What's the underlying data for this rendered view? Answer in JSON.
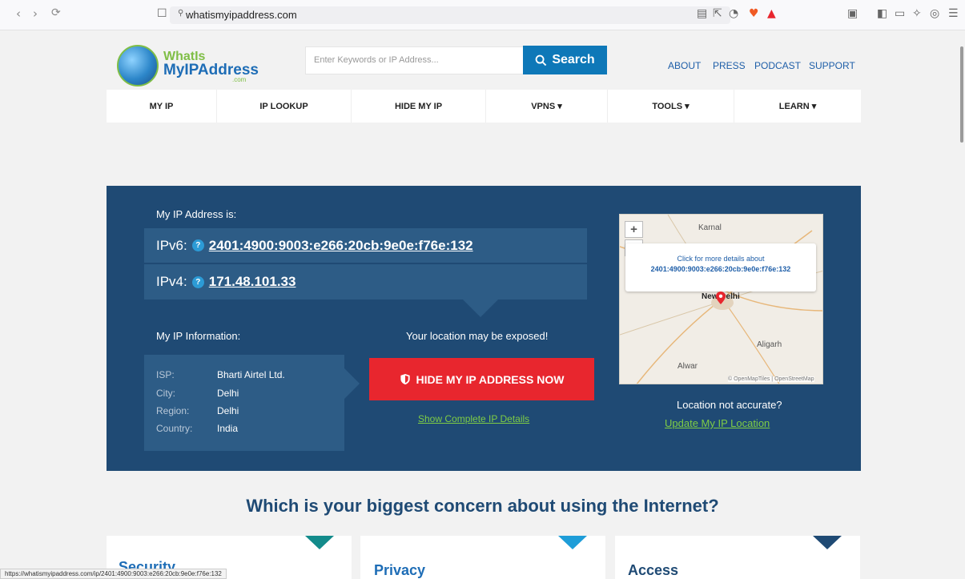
{
  "browser": {
    "url": "whatismyipaddress.com",
    "status_url": "https://whatismyipaddress.com/ip/2401:4900:9003:e266:20cb:9e0e:f76e:132"
  },
  "header": {
    "logo_line1": "WhatIs",
    "logo_line2": "MyIPAddress",
    "logo_com": ".com",
    "search_placeholder": "Enter Keywords or IP Address...",
    "search_label": "Search",
    "links": [
      "ABOUT",
      "PRESS",
      "PODCAST",
      "SUPPORT"
    ]
  },
  "nav": [
    "MY IP",
    "IP LOOKUP",
    "HIDE MY IP",
    "VPNS ▾",
    "TOOLS ▾",
    "LEARN ▾"
  ],
  "hero": {
    "my_ip_label": "My IP Address is:",
    "ipv6_label": "IPv6:",
    "ipv6": "2401:4900:9003:e266:20cb:9e0e:f76e:132",
    "ipv4_label": "IPv4:",
    "ipv4": "171.48.101.33",
    "info_label": "My IP Information:",
    "exposed_label": "Your location may be exposed!",
    "hide_button": "HIDE MY IP ADDRESS NOW",
    "show_details": "Show Complete IP Details",
    "info": {
      "isp_key": "ISP:",
      "isp": "Bharti Airtel Ltd.",
      "city_key": "City:",
      "city": "Delhi",
      "region_key": "Region:",
      "region": "Delhi",
      "country_key": "Country:",
      "country": "India"
    },
    "map": {
      "popup_line1": "Click for more details about",
      "popup_line2": "2401:4900:9003:e266:20cb:9e0e:f76e:132",
      "city_karnal": "Karnal",
      "city_delhi": "New Delhi",
      "city_aligarh": "Aligarh",
      "city_alwar": "Alwar",
      "attribution": "© OpenMapTiles | OpenStreetMap",
      "zoom_in": "+",
      "zoom_out": "−"
    },
    "not_accurate": "Location not accurate?",
    "update_location": "Update My IP Location"
  },
  "concern": {
    "title": "Which is your biggest concern about using the Internet?",
    "cards": [
      {
        "title": "Security",
        "color": "#138b8b"
      },
      {
        "title": "Privacy",
        "color": "#1e9dd8"
      },
      {
        "title": "Access",
        "color": "#1f4a74"
      }
    ]
  },
  "colors": {
    "hero_bg": "#1f4a74",
    "accent_blue": "#0e78b8",
    "hide_red": "#e8262e",
    "link_green": "#7fcd45"
  }
}
